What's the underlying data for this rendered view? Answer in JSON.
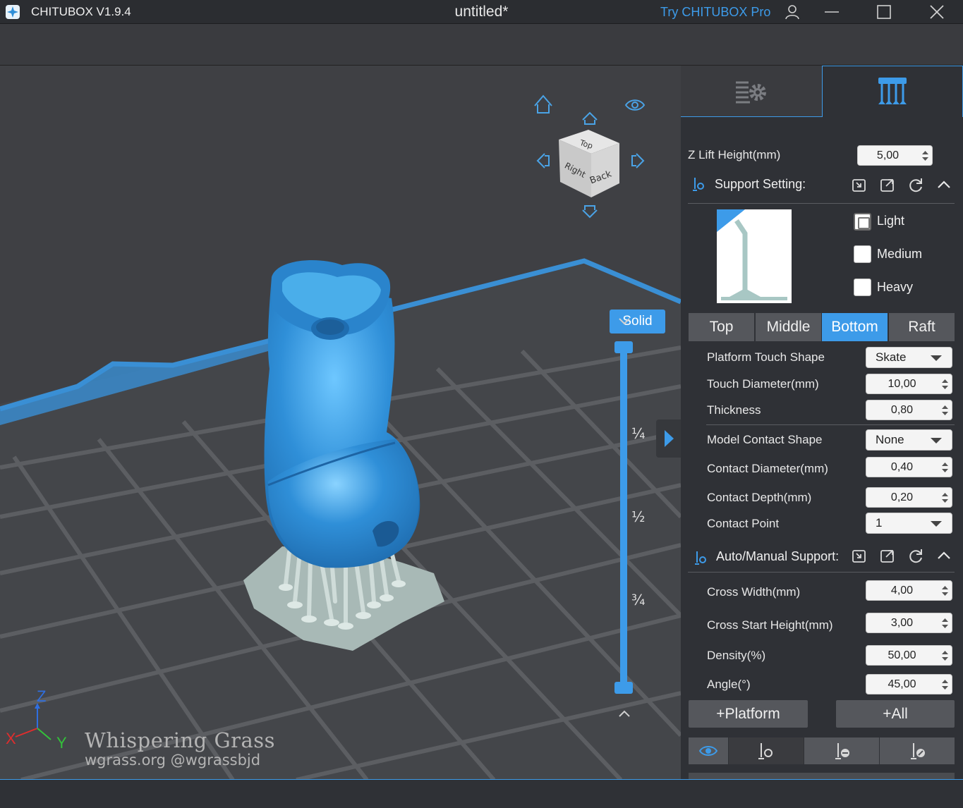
{
  "titlebar": {
    "app_name": "CHITUBOX V1.9.4",
    "doc_title": "untitled*",
    "try_pro": "Try CHITUBOX Pro"
  },
  "viewport": {
    "solid_button": "Solid",
    "slider_labels": [
      "¼",
      "½",
      "¾"
    ],
    "axis_labels": {
      "x": "X",
      "y": "Y",
      "z": "Z"
    },
    "view_cube_faces": {
      "top": "Top",
      "right": "Right",
      "back": "Back"
    },
    "watermark_line1": "Whispering Grass",
    "watermark_line2": "wgrass.org @wgrassbjd"
  },
  "panel": {
    "z_lift": {
      "label": "Z Lift Height(mm)",
      "value": "5,00"
    },
    "support_setting": {
      "title": "Support Setting:"
    },
    "presets": [
      "Light",
      "Medium",
      "Heavy"
    ],
    "preset_checked": "Light",
    "segments": [
      "Top",
      "Middle",
      "Bottom",
      "Raft"
    ],
    "active_segment": "Bottom",
    "bottom_fields": [
      {
        "label": "Platform Touch Shape",
        "kind": "combo",
        "value": "Skate"
      },
      {
        "label": "Touch Diameter(mm)",
        "kind": "spin",
        "value": "10,00"
      },
      {
        "label": "Thickness",
        "kind": "spin",
        "value": "0,80"
      }
    ],
    "model_fields": [
      {
        "label": "Model Contact Shape",
        "kind": "combo",
        "value": "None"
      },
      {
        "label": "Contact Diameter(mm)",
        "kind": "spin",
        "value": "0,40"
      },
      {
        "label": "Contact Depth(mm)",
        "kind": "spin",
        "value": "0,20"
      },
      {
        "label": "Contact Point",
        "kind": "combo",
        "value": "1"
      }
    ],
    "auto_manual": {
      "title": "Auto/Manual Support:"
    },
    "auto_fields": [
      {
        "label": "Cross Width(mm)",
        "value": "4,00"
      },
      {
        "label": "Cross Start Height(mm)",
        "value": "3,00"
      },
      {
        "label": "Density(%)",
        "value": "50,00"
      },
      {
        "label": "Angle(°)",
        "value": "45,00"
      }
    ],
    "platform_button": "+Platform",
    "all_button": "+All"
  },
  "colors": {
    "accent": "#3d9be9",
    "model": "#2f8fd8",
    "panel_bg": "#2f3136",
    "viewport_bg": "#3f4044"
  },
  "slider": {
    "top_value": 1.0,
    "bottom_value": 0.0
  }
}
